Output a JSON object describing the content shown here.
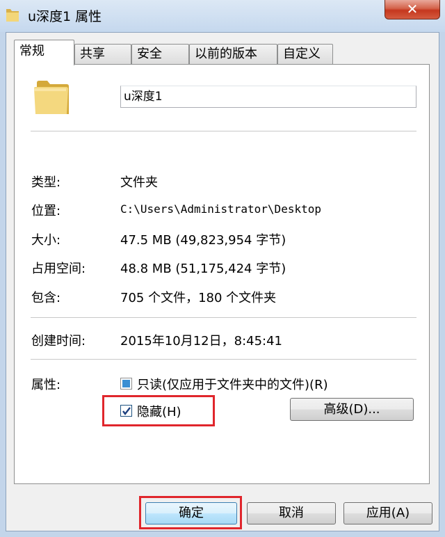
{
  "window": {
    "title": "u深度1 属性",
    "close_symbol": "✕"
  },
  "tabs": [
    {
      "label": "常规",
      "active": true
    },
    {
      "label": "共享"
    },
    {
      "label": "安全"
    },
    {
      "label": "以前的版本"
    },
    {
      "label": "自定义"
    }
  ],
  "general": {
    "folder_name": "u深度1",
    "type_label": "类型:",
    "type_value": "文件夹",
    "location_label": "位置:",
    "location_value": "C:\\Users\\Administrator\\Desktop",
    "size_label": "大小:",
    "size_value": "47.5 MB (49,823,954 字节)",
    "disk_size_label": "占用空间:",
    "disk_size_value": "48.8 MB (51,175,424 字节)",
    "contains_label": "包含:",
    "contains_value": "705 个文件，180 个文件夹",
    "created_label": "创建时间:",
    "created_value": "2015年10月12日，8:45:41",
    "attributes_label": "属性:",
    "readonly_label": "只读(仅应用于文件夹中的文件)(R)",
    "hidden_label": "隐藏(H)",
    "hidden_checked": true,
    "advanced_button": "高级(D)..."
  },
  "buttons": {
    "ok": "确定",
    "cancel": "取消",
    "apply": "应用(A)"
  },
  "colors": {
    "highlight": "#e0262c",
    "titlebar": "#c5d8ee"
  }
}
